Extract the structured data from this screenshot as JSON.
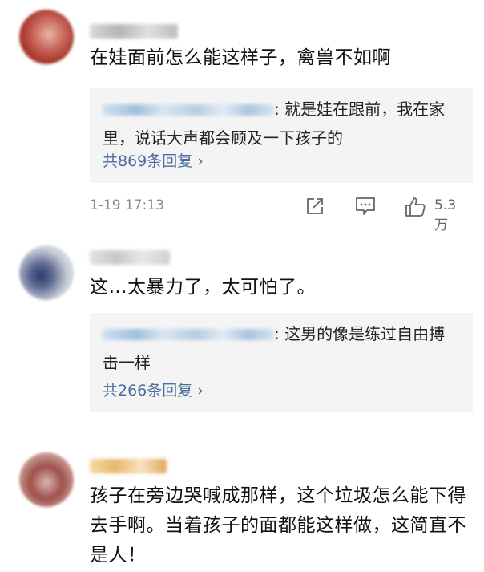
{
  "comments": [
    {
      "text": "在娃面前怎么能这样子，禽兽不如啊",
      "reply_preview": ": 就是娃在跟前，我在家里，说话大声都会顾及一下孩子的",
      "reply_count": "共869条回复 ›",
      "time": "1-19 17:13",
      "likes": "5.3万"
    },
    {
      "text": "这…太暴力了，太可怕了。",
      "reply_preview": ": 这男的像是练过自由搏击一样",
      "reply_count": "共266条回复 ›"
    },
    {
      "text": "孩子在旁边哭喊成那样，这个垃圾怎么能下得去手啊。当着孩子的面都能这样做，这简直不是人！"
    }
  ],
  "icons": {
    "share": "share-icon",
    "comment": "comment-icon",
    "like": "thumbs-up-icon"
  },
  "colors": {
    "link": "#4a6f9e",
    "reply_bg": "#f4f4f4",
    "meta": "#8a8a8a"
  }
}
